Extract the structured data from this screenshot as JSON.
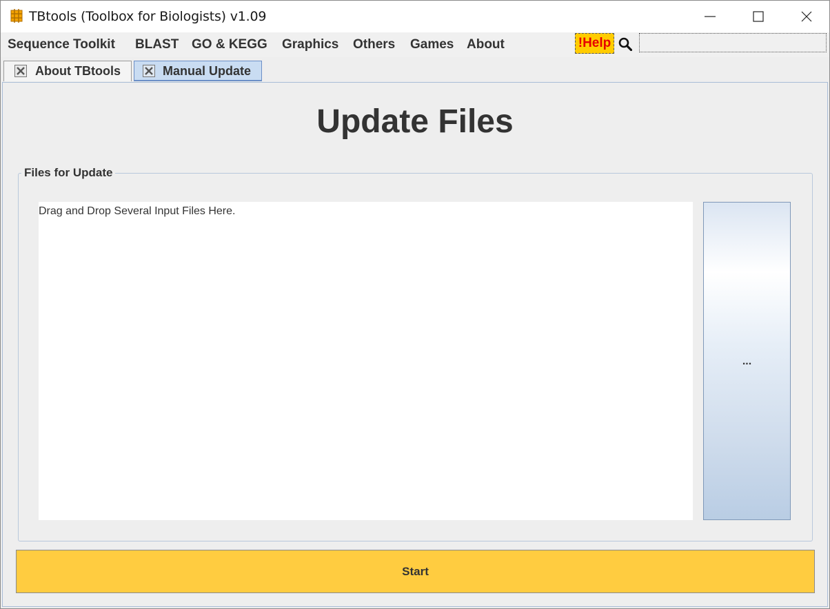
{
  "window": {
    "title": "TBtools (Toolbox for Biologists) v1.09"
  },
  "menu": {
    "items": [
      "Sequence Toolkit",
      "BLAST",
      "GO & KEGG",
      "Graphics",
      "Others",
      "Games",
      "About"
    ],
    "help_label": "!Help",
    "search_placeholder": ""
  },
  "tabs": [
    {
      "label": "About TBtools",
      "active": false
    },
    {
      "label": "Manual Update",
      "active": true
    }
  ],
  "main": {
    "title": "Update Files",
    "group_label": "Files for Update",
    "drop_hint": "Drag and Drop Several Input Files Here.",
    "browse_label": "...",
    "start_label": "Start"
  },
  "colors": {
    "help_bg": "#ffcc00",
    "help_text": "#e60000",
    "start_bg": "#ffcc40",
    "active_tab": "#c9dcf2"
  },
  "icons": {
    "app": "tbtools-app-icon",
    "tab_close": "close-icon",
    "search": "search-icon"
  }
}
